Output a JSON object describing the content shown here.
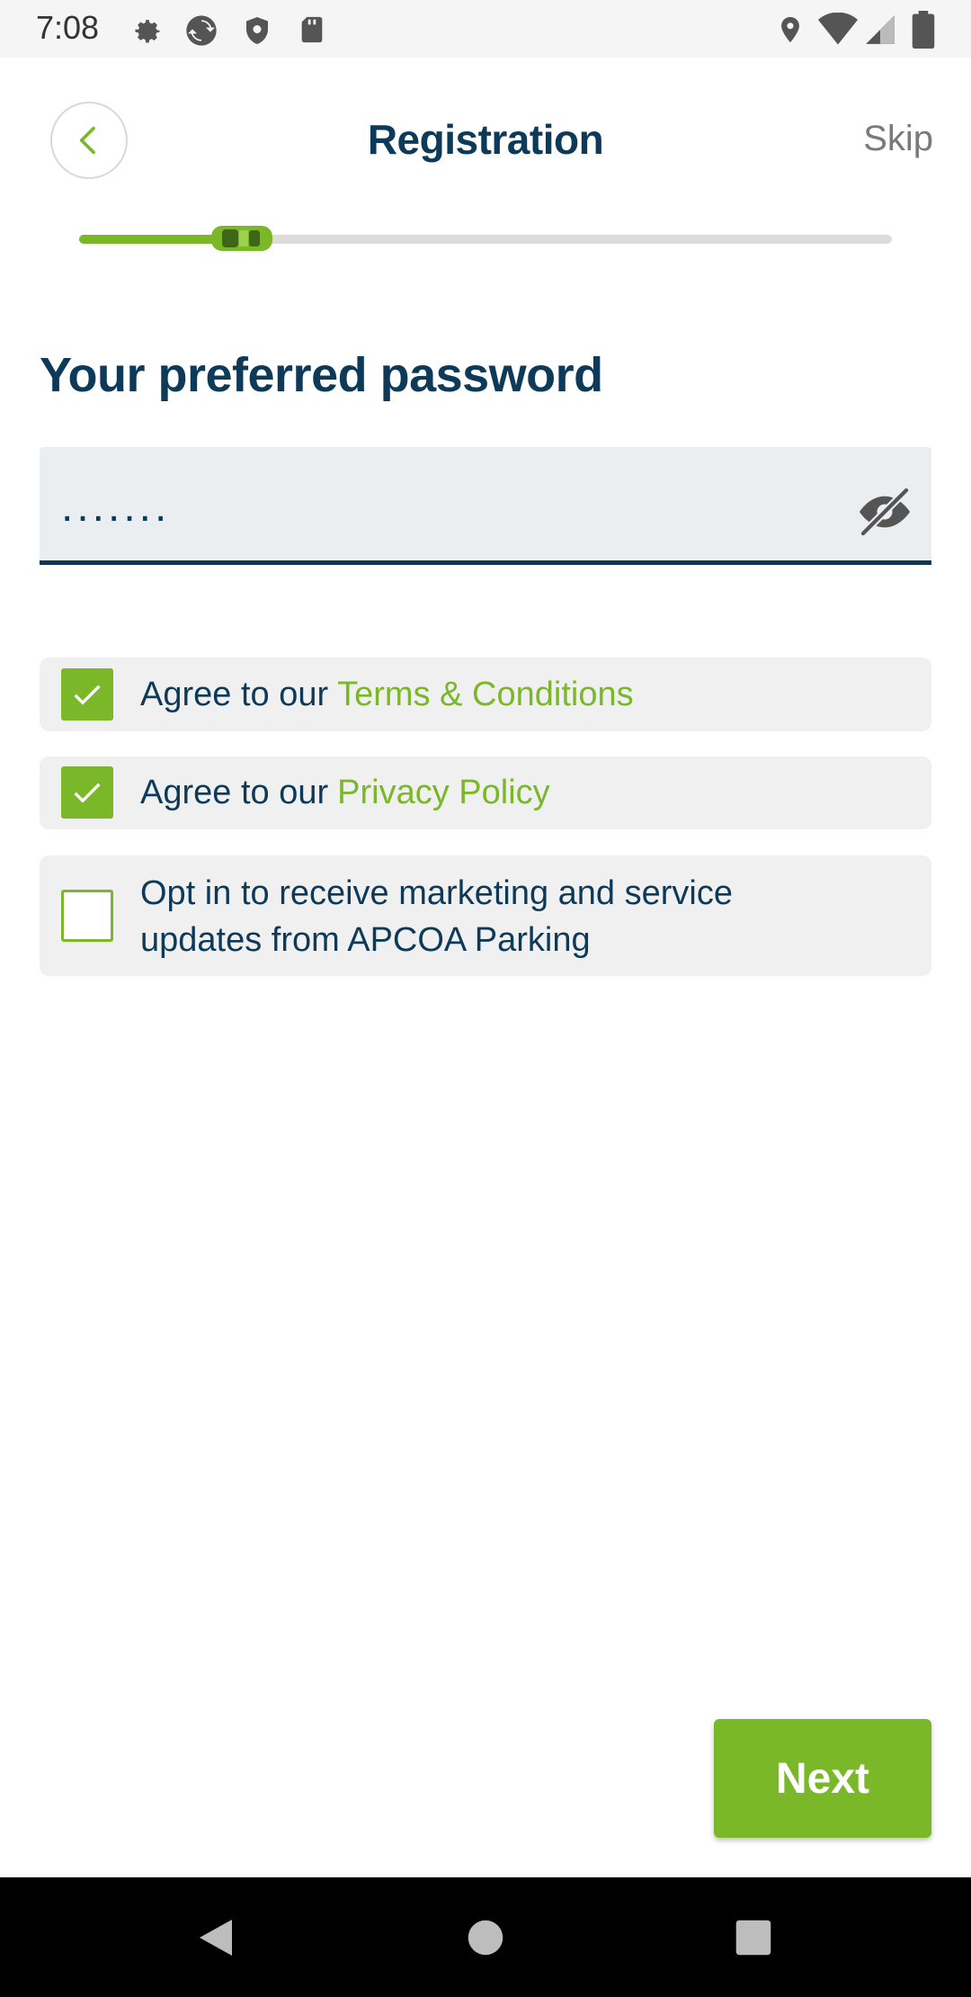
{
  "status_bar": {
    "time": "7:08",
    "left_icons": [
      "settings-icon",
      "sync-icon",
      "shield-icon",
      "sd-card-icon"
    ],
    "right_icons": [
      "location-icon",
      "wifi-icon",
      "signal-icon",
      "battery-icon"
    ]
  },
  "header": {
    "back_icon": "chevron-left-icon",
    "title": "Registration",
    "skip_label": "Skip"
  },
  "progress": {
    "fraction": 0.2,
    "indicator_icon": "car-icon",
    "colors": {
      "fill": "#7ab829",
      "track": "#dcdcdc"
    }
  },
  "password": {
    "title": "Your preferred password",
    "value": ".......",
    "visibility_icon": "eye-off-icon"
  },
  "agreements": [
    {
      "checked": true,
      "text": "Agree to our",
      "link": "Terms & Conditions"
    },
    {
      "checked": true,
      "text": "Agree to our",
      "link": "Privacy Policy"
    },
    {
      "checked": false,
      "text_line1": "Opt in to receive marketing and service",
      "text_line2": "updates from APCOA Parking"
    }
  ],
  "next_label": "Next",
  "nav_bar": [
    "back-icon",
    "home-icon",
    "recents-icon"
  ],
  "colors": {
    "primary": "#0e3a5a",
    "accent": "#7ab829",
    "field_bg": "#ebeef1",
    "row_bg": "#f0f0f0"
  }
}
